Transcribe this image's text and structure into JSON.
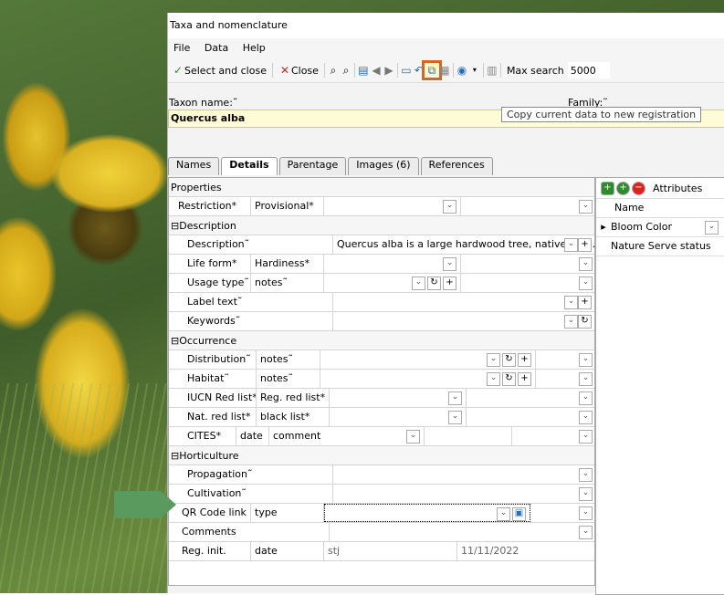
{
  "window": {
    "title": "Taxa and nomenclature"
  },
  "menu": [
    "File",
    "Data",
    "Help"
  ],
  "toolbar": {
    "select_close": "Select and close",
    "close": "Close",
    "max_search_label": "Max search",
    "max_search_value": "5000"
  },
  "tooltip": "Copy current data to new registration",
  "taxon": {
    "label": "Taxon name:˜",
    "value": "Quercus alba",
    "family_label": "Family:˜"
  },
  "tabs": [
    "Names",
    "Details",
    "Parentage",
    "Images (6)",
    "References"
  ],
  "grid": {
    "properties": "Properties",
    "restriction": "Restriction*",
    "provisional": "Provisional*",
    "description_group": "Description",
    "description": "Description˜",
    "description_value": "Quercus alba is a large hardwood tree, native to e...",
    "life_form": "Life form*",
    "hardiness": "Hardiness*",
    "usage_type": "Usage type˜",
    "notes": "notes˜",
    "label_text": "Label text˜",
    "keywords": "Keywords˜",
    "occurrence_group": "Occurrence",
    "distribution": "Distribution˜",
    "habitat": "Habitat˜",
    "iucn": "IUCN Red list*",
    "reg_red": "Reg. red list*",
    "nat_red": "Nat. red list*",
    "black": "black list*",
    "cites": "CITES*",
    "date": "date",
    "comment": "comment",
    "horticulture_group": "Horticulture",
    "propagation": "Propagation˜",
    "cultivation": "Cultivation˜",
    "qr": "QR Code link",
    "type": "type",
    "comments": "Comments",
    "reg_init": "Reg. init.",
    "reg_date": "date",
    "reg_user": "stj",
    "reg_date_value": "11/11/2022"
  },
  "attributes": {
    "label": "Attributes",
    "col_name": "Name",
    "rows": [
      "Bloom Color",
      "Nature Serve status"
    ]
  }
}
